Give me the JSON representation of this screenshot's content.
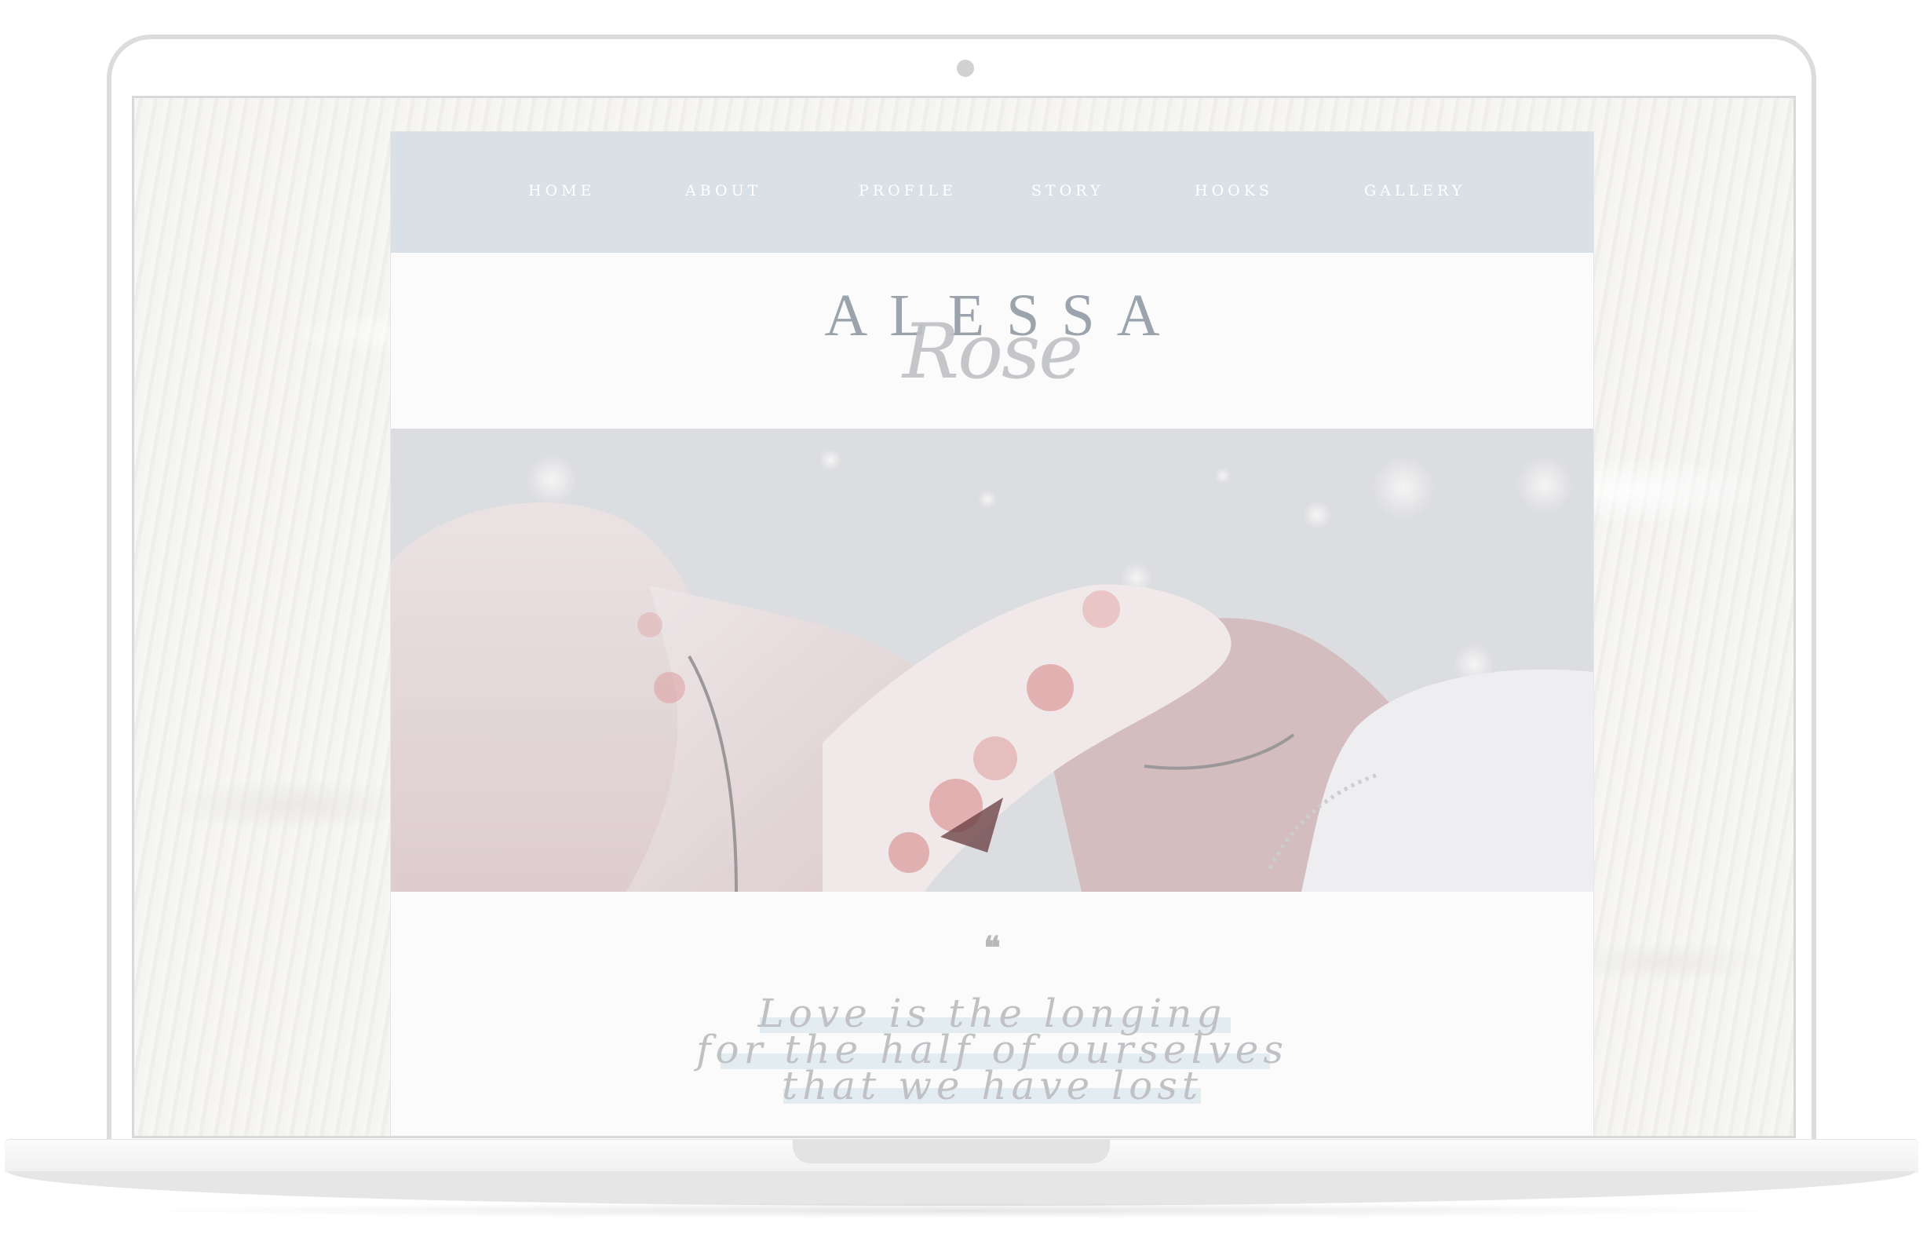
{
  "nav": {
    "items": [
      {
        "label": "HOME"
      },
      {
        "label": "ABOUT"
      },
      {
        "label": "PROFILE"
      },
      {
        "label": "STORY"
      },
      {
        "label": "HOOKS"
      },
      {
        "label": "GALLERY"
      }
    ]
  },
  "logo": {
    "top": "ALESSA",
    "bottom": "Rose"
  },
  "quote": {
    "mark": "❝",
    "lines": [
      "Love is the longing",
      "for the half of ourselves",
      "that we have lost"
    ]
  },
  "colors": {
    "nav_background": "#d9e0e6",
    "nav_text": "#ffffff",
    "logo_text": "#9ba4ad",
    "quote_text": "#c0c1c4",
    "quote_highlight": "#deeaee",
    "page_background": "#fbfbfb"
  }
}
